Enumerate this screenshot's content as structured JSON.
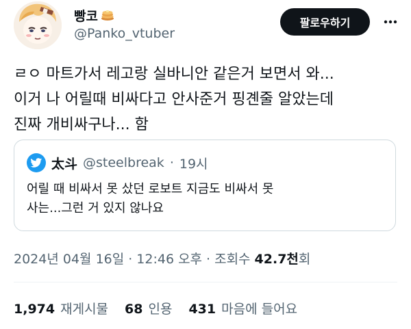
{
  "author": {
    "display_name": "빵코",
    "handle": "@Panko_vtuber",
    "emoji": "pancake-icon"
  },
  "actions": {
    "follow_label": "팔로우하기"
  },
  "tweet": {
    "text": "ㄹㅇ 마트가서 레고랑 실바니안 같은거 보면서 와...\n이거 나 어릴때 비싸다고 안사준거 핑곈줄 알았는데\n진짜 개비싸구나... 함"
  },
  "quote": {
    "name": "太斗",
    "handle": "@steelbreak",
    "separator": "·",
    "time": "19시",
    "text": "어릴 때 비싸서 못 샀던 로보트 지금도 비싸서 못\n사는...그런 거 있지 않나요"
  },
  "meta": {
    "date": "2024년 04월 16일",
    "sep1": "·",
    "time": "12:46 오후",
    "sep2": "·",
    "views_label": "조회수",
    "views_count": "42.7천",
    "views_suffix": "회"
  },
  "stats": {
    "retweets_count": "1,974",
    "retweets_label": "재게시물",
    "quotes_count": "68",
    "quotes_label": "인용",
    "likes_count": "431",
    "likes_label": "마음에 들어요"
  },
  "colors": {
    "text_primary": "#0f1419",
    "text_secondary": "#536471",
    "border": "#cfd9de",
    "twitter_blue": "#1d9bf0",
    "button_dark": "#0f1419"
  }
}
